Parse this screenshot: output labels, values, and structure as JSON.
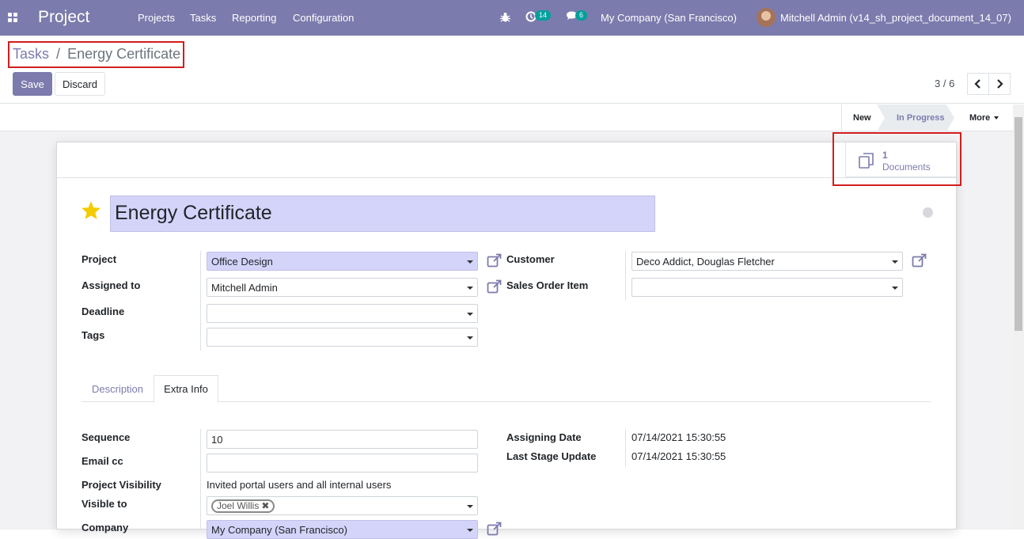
{
  "navbar": {
    "app_title": "Project",
    "menu": [
      "Projects",
      "Tasks",
      "Reporting",
      "Configuration"
    ],
    "activity_count": "14",
    "message_count": "6",
    "company": "My Company (San Francisco)",
    "user": "Mitchell Admin (v14_sh_project_document_14_07)"
  },
  "breadcrumb": {
    "parent": "Tasks",
    "separator": "/",
    "current": "Energy Certificate"
  },
  "buttons": {
    "save": "Save",
    "discard": "Discard"
  },
  "pager": {
    "value": "3 / 6"
  },
  "stages": {
    "new": "New",
    "in_progress": "In Progress",
    "more": "More"
  },
  "smart_button": {
    "count": "1",
    "label": "Documents"
  },
  "task": {
    "title": "Energy Certificate",
    "starred": true
  },
  "fields": {
    "project_label": "Project",
    "project_value": "Office Design",
    "assigned_label": "Assigned to",
    "assigned_value": "Mitchell Admin",
    "deadline_label": "Deadline",
    "deadline_value": "",
    "tags_label": "Tags",
    "tags_value": "",
    "customer_label": "Customer",
    "customer_value": "Deco Addict, Douglas Fletcher",
    "so_label": "Sales Order Item",
    "so_value": ""
  },
  "tabs": [
    "Description",
    "Extra Info"
  ],
  "extra": {
    "sequence_label": "Sequence",
    "sequence_value": "10",
    "emailcc_label": "Email cc",
    "emailcc_value": "",
    "visibility_label": "Project Visibility",
    "visibility_value": "Invited portal users and all internal users",
    "visible_label": "Visible to",
    "visible_tag": "Joel Willis",
    "company_label": "Company",
    "company_value": "My Company (San Francisco)",
    "assign_date_label": "Assigning Date",
    "assign_date_value": "07/14/2021 15:30:55",
    "stage_update_label": "Last Stage Update",
    "stage_update_value": "07/14/2021 15:30:55"
  },
  "colors": {
    "brand": "#7c7bad",
    "highlight": "#d21e1e",
    "badge": "#00a09d",
    "required_field": "#d4d4fb"
  }
}
